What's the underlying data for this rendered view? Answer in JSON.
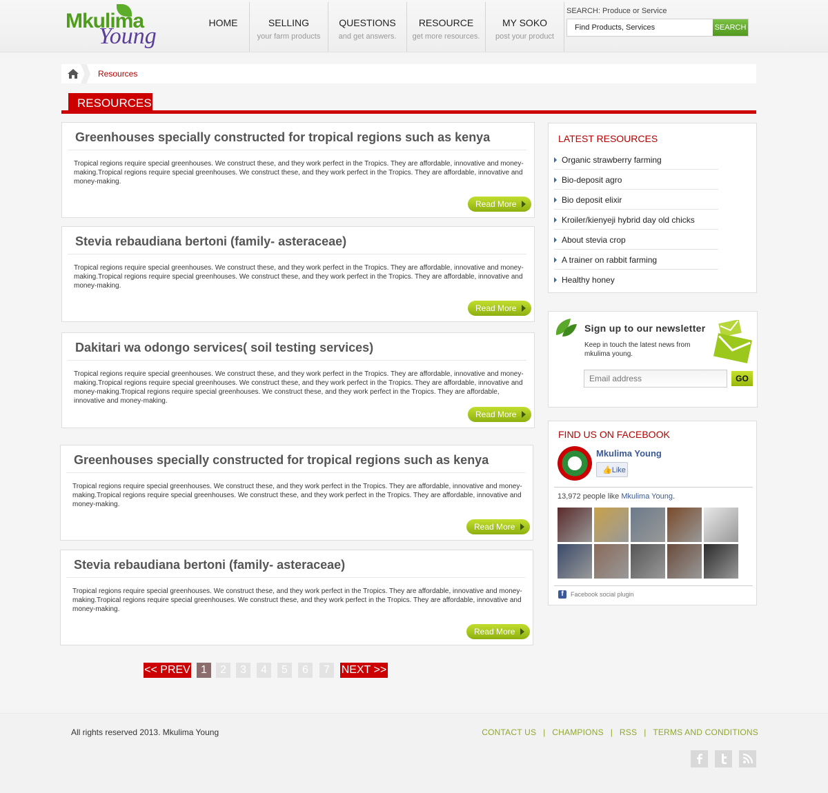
{
  "logo": {
    "main": "Mkulima",
    "sub": "Young"
  },
  "nav": [
    {
      "title": "HOME",
      "sub": ""
    },
    {
      "title": "SELLING",
      "sub": "your farm products"
    },
    {
      "title": "QUESTIONS",
      "sub": "and get answers."
    },
    {
      "title": "RESOURCE",
      "sub": "get more resources."
    },
    {
      "title": "MY SOKO",
      "sub": "post your product"
    }
  ],
  "search": {
    "label": "SEARCH: Produce or Service",
    "value": "Find Products, Services",
    "button": "SEARCH"
  },
  "breadcrumb": {
    "current": "Resources"
  },
  "section_title": "RESOURCES",
  "read_more": "Read More",
  "articles": [
    {
      "title": "Greenhouses specially constructed for tropical regions such as kenya",
      "text": "Tropical regions require special greenhouses. We construct these, and they work perfect in the Tropics. They are affordable, innovative and money-making.Tropical regions require special greenhouses. We construct these, and they work perfect in the Tropics. They are affordable, innovative and money-making."
    },
    {
      "title": "Stevia rebaudiana bertoni (family- asteraceae)",
      "text": "Tropical regions require special greenhouses. We construct these, and they work perfect in the Tropics. They are affordable, innovative and money-making.Tropical regions require special greenhouses. We construct these, and they work perfect in the Tropics. They are affordable, innovative and money-making."
    },
    {
      "title": "Dakitari wa odongo services( soil testing services)",
      "text": "Tropical regions require special greenhouses. We construct these, and they work perfect in the Tropics. They are affordable, innovative and money-making.Tropical regions require special greenhouses. We construct these, and they work perfect in the Tropics. They are affordable, innovative and money-making.Tropical regions require special greenhouses. We construct these, and they work perfect in the Tropics. They are affordable, innovative and money-making."
    },
    {
      "title": "Greenhouses specially constructed for tropical regions such as kenya",
      "text": "Tropical regions require special greenhouses. We construct these, and they work perfect in the Tropics. They are affordable, innovative and money-making.Tropical regions require special greenhouses. We construct these, and they work perfect in the Tropics. They are affordable, innovative and money-making."
    },
    {
      "title": "Stevia rebaudiana bertoni (family- asteraceae)",
      "text": "Tropical regions require special greenhouses. We construct these, and they work perfect in the Tropics. They are affordable, innovative and money-making.Tropical regions require special greenhouses. We construct these, and they work perfect in the Tropics. They are affordable, innovative and money-making."
    }
  ],
  "latest": {
    "title": "LATEST RESOURCES",
    "items": [
      "Organic strawberry farming",
      "Bio-deposit agro",
      "Bio deposit elixir",
      "Kroiler/kienyeji hybrid day old chicks",
      "About stevia crop",
      "A trainer on rabbit farming",
      "Healthy honey"
    ]
  },
  "newsletter": {
    "title": "Sign up to our newsletter",
    "text": "Keep in touch the latest news from mkulima young.",
    "placeholder": "Email address",
    "button": "GO"
  },
  "facebook": {
    "title": "FIND US ON FACEBOOK",
    "page_name": "Mkulima Young",
    "like": "Like",
    "count_prefix": "13,972 people like ",
    "count_name": "Mkulima Young",
    "count_suffix": ".",
    "plugin": "Facebook social plugin",
    "face_colors": [
      "#5a2a2a",
      "#c9a24a",
      "#6b7a8a",
      "#7a4a2a",
      "#e8e8e8",
      "#3a4a6a",
      "#8a6a5a",
      "#555555",
      "#6a4a3a",
      "#2a2a2a"
    ]
  },
  "pagination": {
    "prev": "<< PREV",
    "pages": [
      "1",
      "2",
      "3",
      "4",
      "5",
      "6",
      "7"
    ],
    "active": "1",
    "next": "NEXT >>"
  },
  "footer": {
    "copyright": "All rights reserved 2013. Mkulima Young",
    "links": [
      "CONTACT US",
      "CHAMPIONS",
      "RSS",
      "TERMS AND CONDITIONS"
    ],
    "social": [
      "facebook-icon",
      "twitter-icon",
      "rss-icon"
    ]
  },
  "colors": {
    "brand_red": "#cc0000",
    "brand_green": "#8db010",
    "link_blue": "#3b5998"
  }
}
